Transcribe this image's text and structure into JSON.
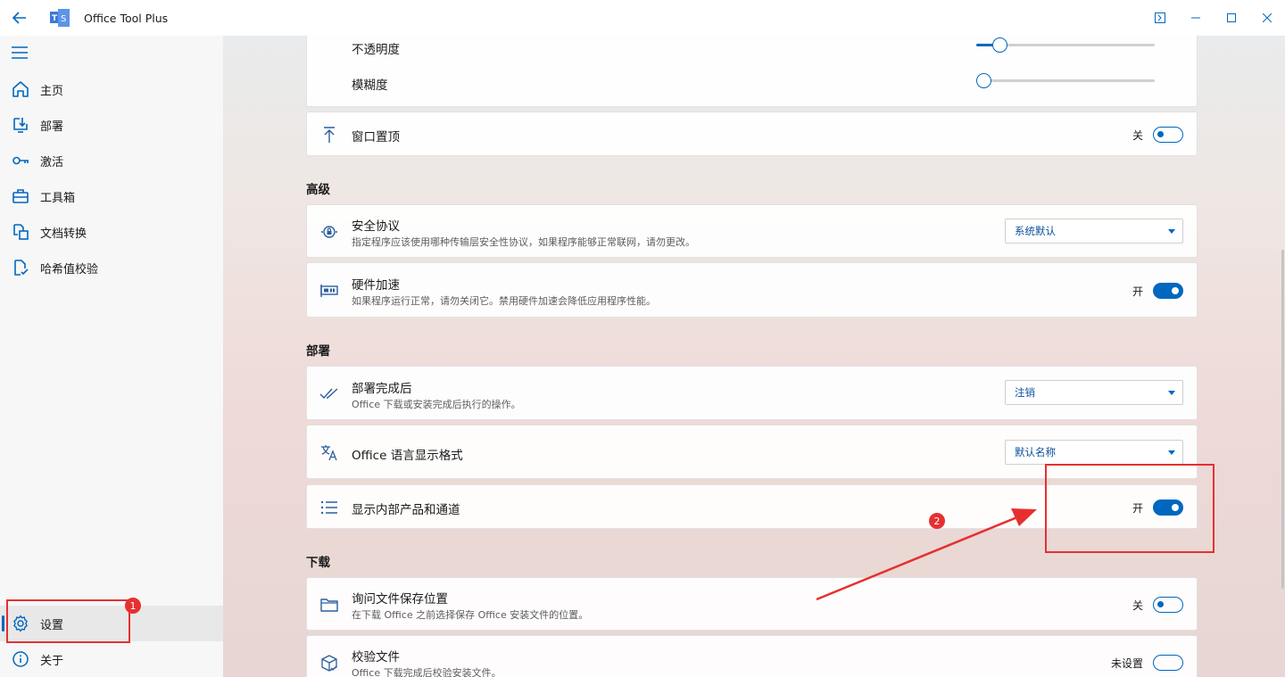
{
  "titlebar": {
    "app_title": "Office Tool Plus",
    "back_icon": "arrow-left-icon",
    "logo_icon": "office-tool-plus-logo",
    "controls": [
      "pane-toggle-icon",
      "minimize-icon",
      "maximize-icon",
      "close-icon"
    ]
  },
  "sidebar": {
    "menu_icon": "hamburger-icon",
    "items": [
      {
        "label": "主页",
        "icon": "home-icon"
      },
      {
        "label": "部署",
        "icon": "deploy-icon"
      },
      {
        "label": "激活",
        "icon": "key-icon"
      },
      {
        "label": "工具箱",
        "icon": "toolbox-icon"
      },
      {
        "label": "文档转换",
        "icon": "document-convert-icon"
      },
      {
        "label": "哈希值校验",
        "icon": "hash-check-icon"
      }
    ],
    "bottom_items": [
      {
        "label": "设置",
        "icon": "gear-icon",
        "active": true
      },
      {
        "label": "关于",
        "icon": "info-icon"
      }
    ]
  },
  "main": {
    "appearance_card": {
      "opacity_label": "不透明度",
      "opacity_value": 0.13,
      "blur_label": "模糊度",
      "blur_value": 0.0
    },
    "always_on_top": {
      "title": "窗口置顶",
      "state": "关",
      "on": false,
      "icon": "pin-top-icon"
    },
    "sections": {
      "advanced": "高级",
      "deploy": "部署",
      "download": "下载"
    },
    "security_protocol": {
      "title": "安全协议",
      "desc": "指定程序应该使用哪种传输层安全性协议，如果程序能够正常联网，请勿更改。",
      "value": "系统默认",
      "icon": "shield-lock-icon"
    },
    "hardware_accel": {
      "title": "硬件加速",
      "desc": "如果程序运行正常，请勿关闭它。禁用硬件加速会降低应用程序性能。",
      "state": "开",
      "on": true,
      "icon": "gpu-icon"
    },
    "after_deploy": {
      "title": "部署完成后",
      "desc": "Office 下载或安装完成后执行的操作。",
      "value": "注销",
      "icon": "double-check-icon"
    },
    "language_format": {
      "title": "Office 语言显示格式",
      "value": "默认名称",
      "icon": "translate-icon"
    },
    "internal_channels": {
      "title": "显示内部产品和通道",
      "state": "开",
      "on": true,
      "icon": "list-icon"
    },
    "ask_save_location": {
      "title": "询问文件保存位置",
      "desc": "在下载 Office 之前选择保存 Office 安装文件的位置。",
      "state": "关",
      "on": false,
      "icon": "folder-icon"
    },
    "verify_files": {
      "title": "校验文件",
      "desc": "Office 下载完成后校验安装文件。",
      "state": "未设置",
      "on": false,
      "icon": "package-check-icon"
    }
  },
  "annotations": {
    "badge_1": "1",
    "badge_2": "2",
    "color": "#e63030"
  },
  "colors": {
    "accent": "#0067c0",
    "annotation": "#e63030"
  }
}
